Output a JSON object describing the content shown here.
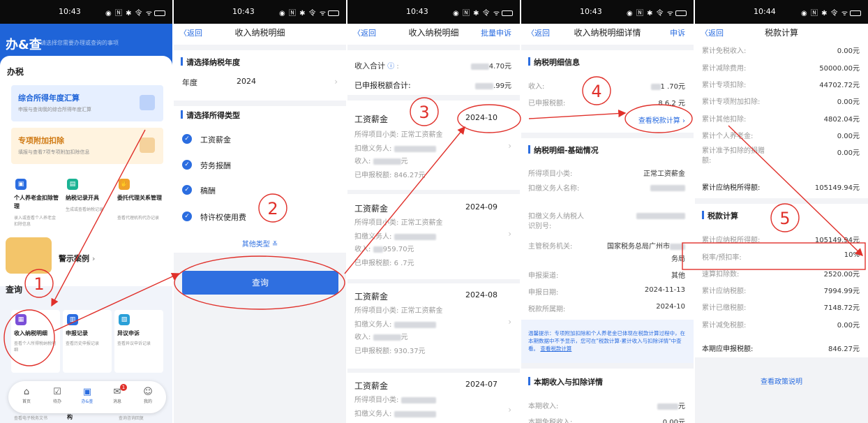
{
  "status": {
    "times": [
      "10:43",
      "10:43",
      "10:43",
      "10:43",
      "10:44"
    ],
    "icons": "◉ 🄽 ✱ 令 ᯤ"
  },
  "panel1": {
    "logo": "办&查",
    "tagline": "请选择您需要办理或查询的事项",
    "section_tax": "办税",
    "card_annual": {
      "title": "综合所得年度汇算",
      "desc": "申报与查询我的综合所得年度汇算"
    },
    "card_special": {
      "title": "专项附加扣除",
      "desc": "填报与查看7项专项附加扣除信息"
    },
    "tiles": [
      {
        "title": "个人养老金扣除管理",
        "desc": "录入或查看个人养老金扣除信息"
      },
      {
        "title": "纳税记录开具",
        "desc": "生成或查看纳税记录"
      },
      {
        "title": "委托代理关系管理",
        "desc": "查看代理机构代办记录"
      }
    ],
    "warning_case": "警示案例",
    "section_query": "查询",
    "query_tiles": [
      {
        "title": "收入纳税明细",
        "desc": "查看个人所得税纳税明细"
      },
      {
        "title": "申报记录",
        "desc": "查看历史申报记录"
      },
      {
        "title": "异议申诉",
        "desc": "查看异议申诉记录"
      }
    ],
    "bottom_partial": [
      "查看电子税务文书",
      "构",
      "查询咨询回复"
    ],
    "tabs": [
      "首页",
      "待办",
      "办&查",
      "消息",
      "我的"
    ],
    "badge": "1"
  },
  "panel2": {
    "back": "〈返回",
    "title": "收入纳税明细",
    "section_year": "请选择纳税年度",
    "year_label": "年度",
    "year_value": "2024",
    "section_type": "请选择所得类型",
    "options": [
      "工资薪金",
      "劳务报酬",
      "稿酬",
      "特许权使用费"
    ],
    "more_types": "其他类型",
    "query_button": "查询"
  },
  "panel3": {
    "back": "〈返回",
    "title": "收入纳税明细",
    "action": "批量申诉",
    "income_total_label": "收入合计",
    "income_total_value": "4.70元",
    "tax_total_label": "已申报税额合计:",
    "tax_total_value": ".99元",
    "field_subcategory": "所得项目小类:",
    "field_subcategory_value": "正常工资薪金",
    "field_withholder": "扣缴义务人:",
    "field_income": "收入:",
    "field_tax": "已申报税额:",
    "records": [
      {
        "type": "工资薪金",
        "month": "2024-10",
        "income": "元",
        "tax": "846.27元"
      },
      {
        "type": "工资薪金",
        "month": "2024-09",
        "income": "959.70元",
        "tax": "6 .7元"
      },
      {
        "type": "工资薪金",
        "month": "2024-08",
        "income": "元",
        "tax": "930.37元"
      },
      {
        "type": "工资薪金",
        "month": "2024-07",
        "income": "",
        "tax": ""
      }
    ]
  },
  "panel4": {
    "back": "〈返回",
    "title": "收入纳税明细详情",
    "action": "申诉",
    "section_info": "纳税明细信息",
    "income_label": "收入:",
    "income_value": "1 .70元",
    "tax_label": "已申报税额:",
    "tax_value": "8 6.2 元",
    "view_calc": "查看税款计算",
    "section_basic": "纳税明细-基础情况",
    "rows": [
      {
        "label": "所得项目小类:",
        "value": "正常工资薪金"
      },
      {
        "label": "扣缴义务人名称:",
        "value": ""
      },
      {
        "label": "扣缴义务人纳税人识别号:",
        "value": ""
      },
      {
        "label": "主管税务机关:",
        "value": "国家税务总局广州市"
      },
      {
        "label": "申报渠道:",
        "value": "其他"
      },
      {
        "label": "申报日期:",
        "value": "2024-11-13"
      },
      {
        "label": "税款所属期:",
        "value": "2024-10"
      }
    ],
    "tax_office_suffix": "务局",
    "notice": "温馨提示：专项附加扣除和个人养老金已体现在税款计算过程中，在本期数据中不予显示，您可在\"税款计算-累计收入与扣除详情\"中查看。",
    "notice_link": "查看税款计算",
    "section_period": "本期收入与扣除详情",
    "period_income_label": "本期收入:",
    "period_income_value": "元",
    "period_exempt_label": "本期免税收入:",
    "period_exempt_value": "0.00元"
  },
  "panel5": {
    "back": "〈返回",
    "title": "税款计算",
    "rows_top": [
      {
        "label": "累计免税收入:",
        "value": "0.00元"
      },
      {
        "label": "累计减除费用:",
        "value": "50000.00元"
      },
      {
        "label": "累计专项扣除:",
        "value": "44702.72元"
      },
      {
        "label": "累计专项附加扣除:",
        "value": "0.00元"
      },
      {
        "label": "累计其他扣除:",
        "value": "4802.04元"
      },
      {
        "label": "累计个人养老金:",
        "value": "0.00元"
      },
      {
        "label": "累计准予扣除的捐赠额:",
        "value": "0.00元"
      }
    ],
    "taxable_label": "累计应纳税所得额:",
    "taxable_value": "105149.94元",
    "section_calc": "税款计算",
    "rows_calc": [
      {
        "label": "累计应纳税所得额:",
        "value": "105149.94元"
      },
      {
        "label": "税率/预扣率:",
        "value": "10%"
      },
      {
        "label": "速算扣除数:",
        "value": "2520.00元"
      },
      {
        "label": "累计应纳税额:",
        "value": "7994.99元"
      },
      {
        "label": "累计已缴税额:",
        "value": "7148.72元"
      },
      {
        "label": "累计减免税额:",
        "value": "0.00元"
      }
    ],
    "current_label": "本期应申报税额:",
    "current_value": "846.27元",
    "policy_link": "查看政策说明"
  },
  "annotations": [
    "1",
    "2",
    "3",
    "4",
    "5"
  ],
  "colors": {
    "primary": "#2b6de0",
    "annotation_red": "#e0302a",
    "header_blue": "#1f64d8"
  }
}
